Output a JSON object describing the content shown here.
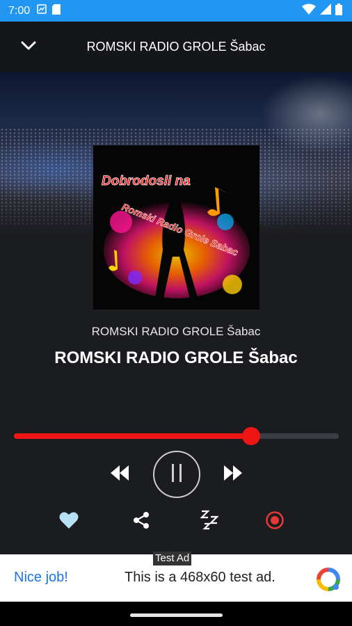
{
  "status_bar": {
    "time": "7:00",
    "background": "#2196f3",
    "left_icons": [
      "photo-icon",
      "sd-card-icon"
    ],
    "right_icons": [
      "wifi-icon",
      "signal-icon",
      "battery-icon"
    ]
  },
  "header": {
    "title": "ROMSKI RADIO GROLE Šabac",
    "back_icon": "chevron-down-icon"
  },
  "album_art": {
    "line1": "Dobrodosli na",
    "line2": "Romski Radio Grole Sabac"
  },
  "now_playing": {
    "station_small": "ROMSKI RADIO GROLE Šabac",
    "station_big": "ROMSKI RADIO GROLE Šabac"
  },
  "progress": {
    "percent": 73,
    "color": "#f01515"
  },
  "controls": {
    "rewind_icon": "rewind-icon",
    "play_pause_icon": "pause-icon",
    "forward_icon": "fast-forward-icon"
  },
  "actions": [
    {
      "icon": "heart-icon",
      "color": "#b8e0f5"
    },
    {
      "icon": "share-icon",
      "color": "#ffffff"
    },
    {
      "icon": "sleep-timer-icon",
      "color": "#ffffff"
    },
    {
      "icon": "record-icon",
      "color": "#e53935"
    }
  ],
  "ad": {
    "tag": "Test Ad",
    "nice": "Nice job!",
    "text": "This is a 468x60 test ad."
  }
}
